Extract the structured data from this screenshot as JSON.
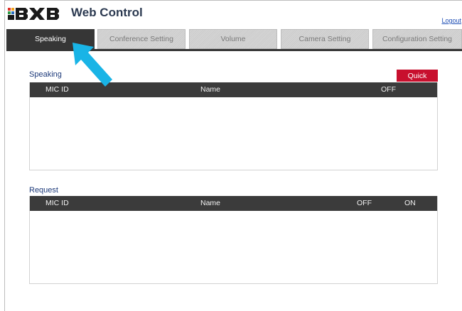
{
  "header": {
    "logo_text": "BXB",
    "title": "Web Control",
    "logout_label": "Logout"
  },
  "tabs": [
    {
      "label": "Speaking",
      "active": true
    },
    {
      "label": "Conference Setting",
      "active": false
    },
    {
      "label": "Volume",
      "active": false
    },
    {
      "label": "Camera Setting",
      "active": false
    },
    {
      "label": "Configuration Setting",
      "active": false
    }
  ],
  "speaking": {
    "title": "Speaking",
    "quick_label": "Quick",
    "columns": {
      "mic_id": "MIC ID",
      "name": "Name",
      "off": "OFF"
    },
    "rows": []
  },
  "request": {
    "title": "Request",
    "columns": {
      "mic_id": "MIC ID",
      "name": "Name",
      "off": "OFF",
      "on": "ON"
    },
    "rows": []
  },
  "colors": {
    "accent_dark": "#363636",
    "quick_red": "#c8102e",
    "arrow_cyan": "#19b4e6",
    "title_blue": "#1d3a7a"
  }
}
